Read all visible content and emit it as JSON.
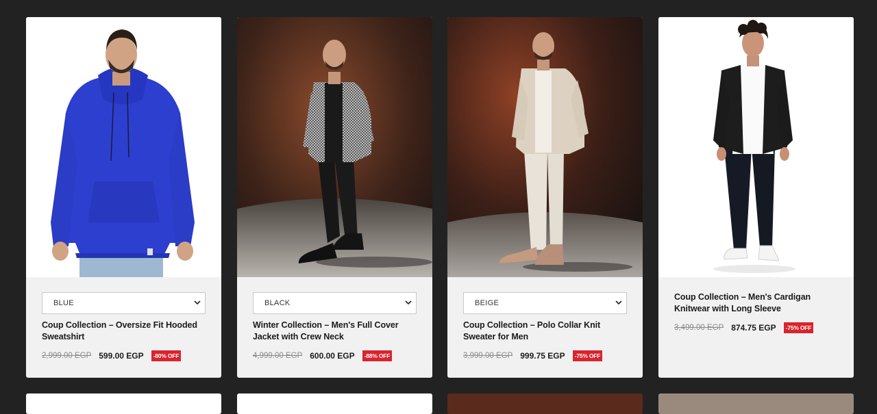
{
  "products": [
    {
      "image": "Man wearing blue oversize hooded sweatshirt",
      "variant": "BLUE",
      "title": "Coup Collection – Oversize Fit Hooded Sweatshirt",
      "old_price": "2,999.00 EGP",
      "new_price": "599.00 EGP",
      "badge": "-80% OFF"
    },
    {
      "image": "Man wearing full cover jacket with crew neck",
      "variant": "BLACK",
      "title": "Winter Collection – Men's Full Cover Jacket with Crew Neck",
      "old_price": "4,999.00 EGP",
      "new_price": "600.00 EGP",
      "badge": "-88% OFF"
    },
    {
      "image": "Man wearing beige polo collar knit sweater",
      "variant": "BEIGE",
      "title": "Coup Collection – Polo Collar Knit Sweater for Men",
      "old_price": "3,999.00 EGP",
      "new_price": "999.75 EGP",
      "badge": "-75% OFF"
    },
    {
      "image": "Man wearing black cardigan knitwear",
      "variant": null,
      "title": "Coup Collection – Men's Cardigan Knitwear with Long Sleeve",
      "old_price": "3,499.00 EGP",
      "new_price": "874.75 EGP",
      "badge": "-75% OFF"
    }
  ],
  "colors": {
    "page_background": "#222222",
    "card_background": "#f1f1f1",
    "badge_red": "#d9232d"
  },
  "icons": {
    "select_arrow": "chevron-down-icon"
  }
}
